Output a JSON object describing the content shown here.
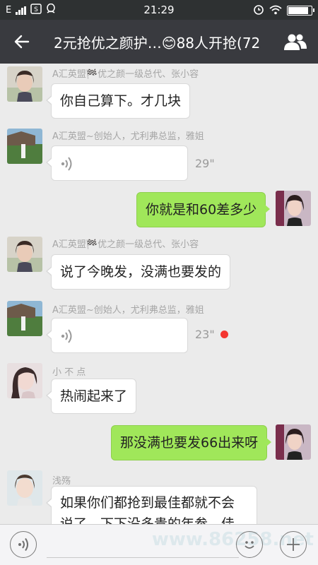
{
  "status_bar": {
    "network": "E",
    "time": "21:29"
  },
  "header": {
    "title": "2元抢优之颜护…😊88人开抢(72"
  },
  "messages": [
    {
      "sender": "A汇英盟🏁优之颜一级总代、张小容",
      "text": "你自己算下。才几块"
    },
    {
      "sender": "A汇英盟~创始人，尤利弗总监，雅姐",
      "duration": "29\""
    },
    {
      "text": "你就是和60差多少"
    },
    {
      "sender": "A汇英盟🏁优之颜一级总代、张小容",
      "text": "说了今晚发，没满也要发的"
    },
    {
      "sender": "A汇英盟~创始人，尤利弗总监，雅姐",
      "duration": "23\""
    },
    {
      "sender": "小 不 点",
      "text": "热闹起来了"
    },
    {
      "text": "那没满也要发66出来呀"
    },
    {
      "sender": "浅殇",
      "text_line1": "如果你们都抢到最佳都就不会",
      "text_line2": "说了，下下没多贵的年参，佳"
    }
  ],
  "watermark": "www.86258.net",
  "colors": {
    "bubble_green": "#a0e75a",
    "header_bg": "#393a3f",
    "unread": "#f43530"
  },
  "icons": {
    "back": "arrow-left-icon",
    "members": "group-icon",
    "voice": "voice-wave-icon",
    "emoji": "emoji-icon",
    "add": "plus-icon"
  }
}
